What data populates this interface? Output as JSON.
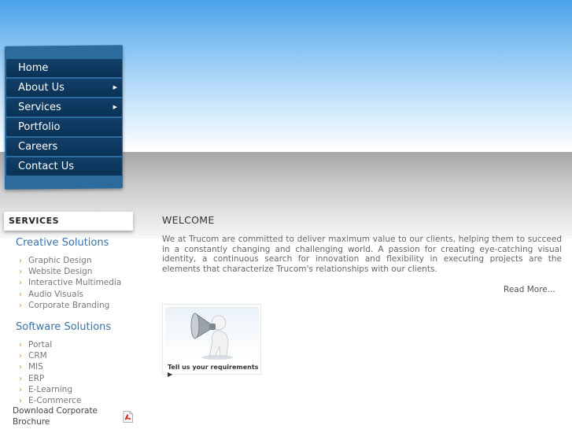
{
  "nav": {
    "items": [
      {
        "label": "Home"
      },
      {
        "label": "About Us"
      },
      {
        "label": "Services"
      },
      {
        "label": "Portfolio"
      },
      {
        "label": "Careers"
      },
      {
        "label": "Contact Us"
      }
    ],
    "submenu_arrow": "▶"
  },
  "sidebar": {
    "heading": "SERVICES",
    "categories": [
      {
        "title": "Creative Solutions",
        "items": [
          "Graphic Design",
          "Website Design",
          "Interactive Multimedia",
          "Audio Visuals",
          "Corporate Branding"
        ]
      },
      {
        "title": "Software Solutions",
        "items": [
          "Portal",
          "CRM",
          "MIS",
          "ERP",
          "E-Learning",
          "E-Commerce"
        ]
      }
    ],
    "bullet": "›",
    "brochure": "Download Corporate Brochure",
    "brochure_icon": "pdf-icon"
  },
  "main": {
    "title": "WELCOME",
    "body": "We at Trucom are committed to deliver maximum value to our clients, helping them to succeed in a constantly changing and challenging world. A passion for creating eye-catching visual identity, a continuous search for innovation and flexibility in executing projects are the elements that characterize Trucom's relationships with our clients.",
    "read_more": "Read More...",
    "requirements_card": {
      "label": "Tell us your requirements ▶",
      "icon": "megaphone-icon"
    }
  },
  "colors": {
    "nav_bg": "#0b3256",
    "nav_panel": "#2c6b9e",
    "category_title": "#3a72a6",
    "bullet": "#e08a3c"
  }
}
